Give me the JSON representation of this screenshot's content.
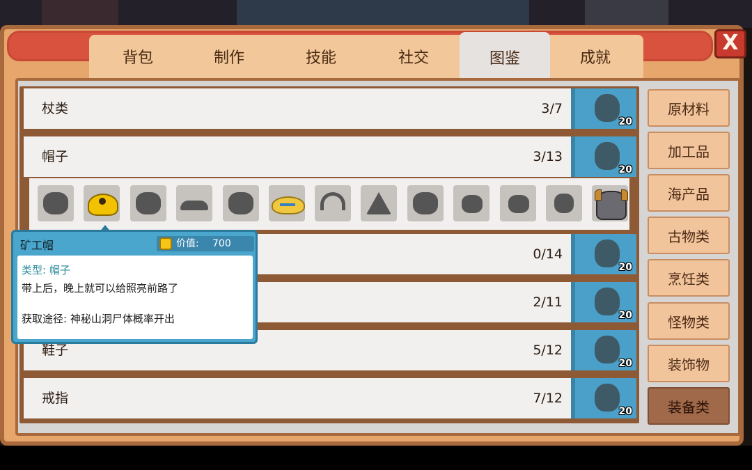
{
  "tabs": [
    "背包",
    "制作",
    "技能",
    "社交",
    "图鉴",
    "成就"
  ],
  "active_tab": "图鉴",
  "close_label": "X",
  "rows": [
    {
      "name": "杖类",
      "count": "3/7",
      "medal": "20"
    },
    {
      "name": "帽子",
      "count": "3/13",
      "medal": "20"
    },
    {
      "name": "",
      "count": "0/14",
      "medal": "20"
    },
    {
      "name": "",
      "count": "2/11",
      "medal": "20"
    },
    {
      "name": "鞋子",
      "count": "5/12",
      "medal": "20"
    },
    {
      "name": "戒指",
      "count": "7/12",
      "medal": "20"
    }
  ],
  "hat_items": [
    {
      "icon": "locked-hat-silhouette-icon"
    },
    {
      "icon": "miner-hat-icon"
    },
    {
      "icon": "locked-hat-silhouette-icon"
    },
    {
      "icon": "locked-hat-silhouette-icon"
    },
    {
      "icon": "locked-hat-silhouette-icon"
    },
    {
      "icon": "straw-hat-icon"
    },
    {
      "icon": "locked-hat-silhouette-icon"
    },
    {
      "icon": "locked-hat-silhouette-icon"
    },
    {
      "icon": "locked-hat-silhouette-icon"
    },
    {
      "icon": "locked-hat-silhouette-icon"
    },
    {
      "icon": "locked-hat-silhouette-icon"
    },
    {
      "icon": "locked-hat-silhouette-icon"
    },
    {
      "icon": "horned-helmet-icon"
    }
  ],
  "categories": [
    "原材料",
    "加工品",
    "海产品",
    "古物类",
    "烹饪类",
    "怪物类",
    "装饰物",
    "装备类"
  ],
  "active_category": "装备类",
  "tooltip": {
    "title": "矿工帽",
    "price_label": "价值:",
    "price_value": "700",
    "type": "类型: 帽子",
    "description": "带上后，晚上就可以给照亮前路了",
    "source": "获取途径: 神秘山洞尸体概率开出"
  },
  "colors": {
    "frame": "#e6a66c",
    "title_bar": "#d9523e",
    "medal_bg": "#4aa0c8",
    "tooltip_bg": "#4aa6cc",
    "active_category": "#a0694a"
  }
}
